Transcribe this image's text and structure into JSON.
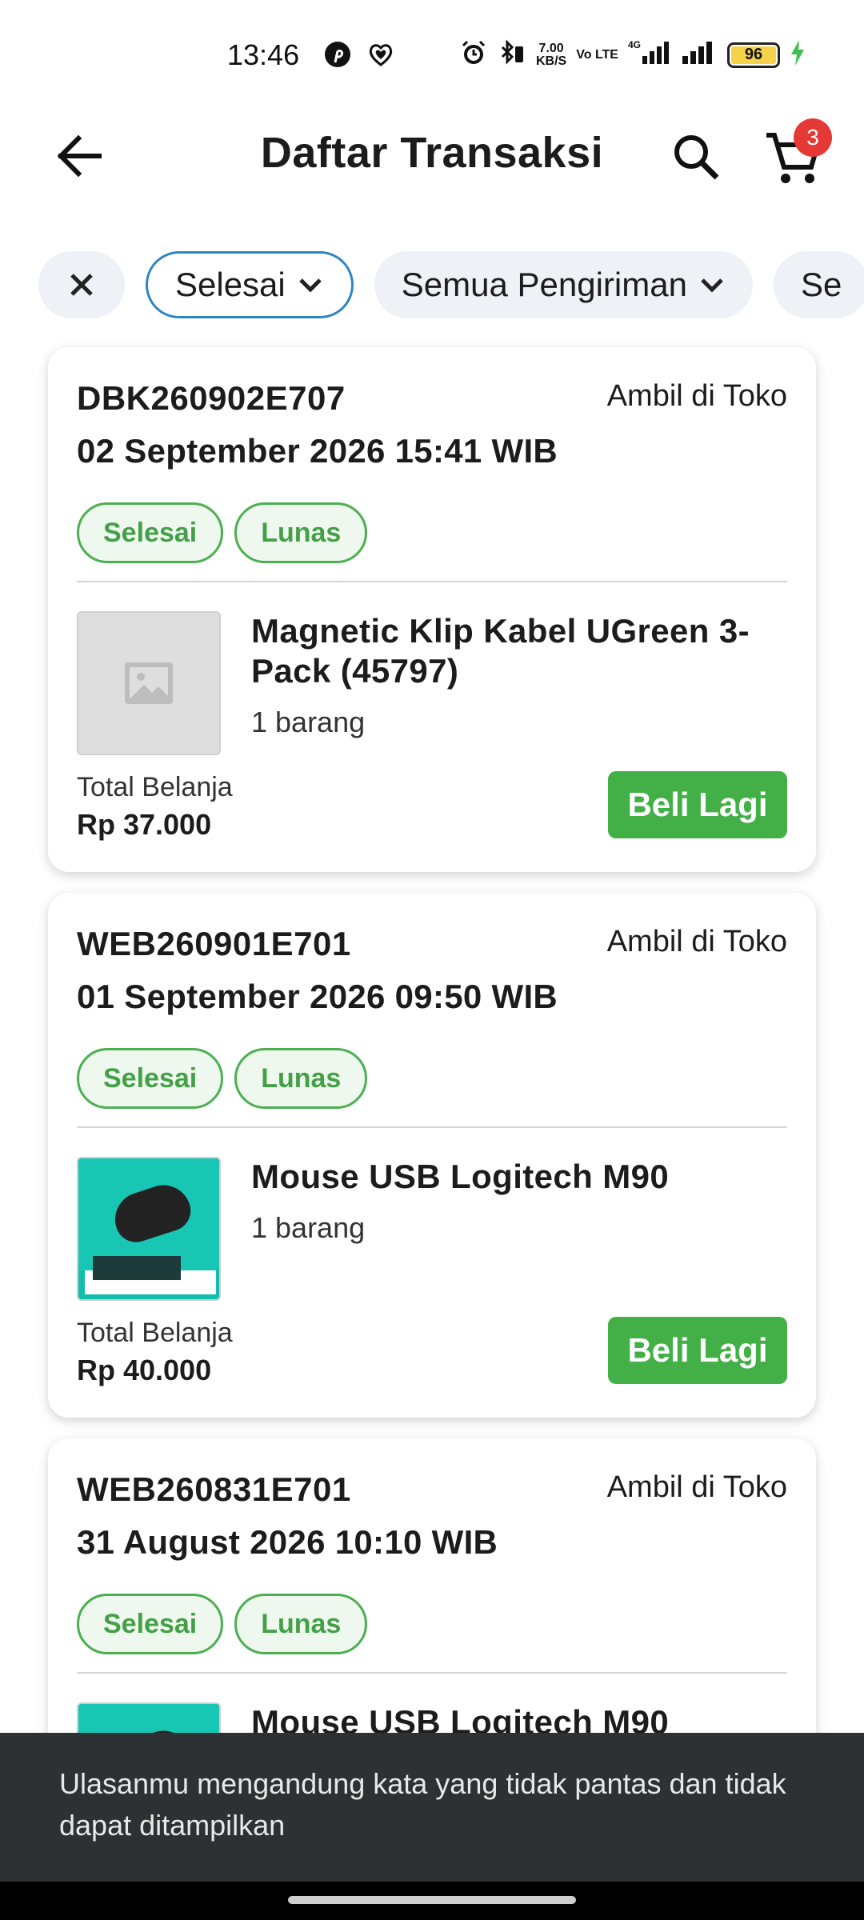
{
  "status_bar": {
    "time": "13:46",
    "net_speed_value": "7.00",
    "net_speed_unit": "KB/S",
    "volte": "Vo LTE",
    "network": "4G",
    "battery": "96"
  },
  "app_bar": {
    "title": "Daftar Transaksi",
    "cart_count": "3"
  },
  "filters": {
    "status": "Selesai",
    "shipping": "Semua Pengiriman",
    "more": "Se"
  },
  "orders": [
    {
      "id": "DBK260902E707",
      "date": "02 September 2026 15:41 WIB",
      "delivery": "Ambil di Toko",
      "status": "Selesai",
      "payment": "Lunas",
      "product_name": "Magnetic Klip Kabel UGreen 3-Pack (45797)",
      "qty": "1 barang",
      "total_label": "Total Belanja",
      "total": "Rp 37.000",
      "action": "Beli Lagi"
    },
    {
      "id": "WEB260901E701",
      "date": "01 September 2026 09:50 WIB",
      "delivery": "Ambil di Toko",
      "status": "Selesai",
      "payment": "Lunas",
      "product_name": "Mouse USB Logitech M90",
      "qty": "1 barang",
      "total_label": "Total Belanja",
      "total": "Rp 40.000",
      "action": "Beli Lagi"
    },
    {
      "id": "WEB260831E701",
      "date": "31 August 2026 10:10 WIB",
      "delivery": "Ambil di Toko",
      "status": "Selesai",
      "payment": "Lunas",
      "product_name": "Mouse USB Logitech M90"
    }
  ],
  "snackbar": {
    "message": "Ulasanmu mengandung kata yang tidak pantas dan tidak dapat ditampilkan"
  },
  "colors": {
    "accent_green": "#43b047",
    "chip_border_blue": "#2e86c1",
    "badge_red": "#e53935",
    "snackbar_bg": "#2e3133"
  }
}
